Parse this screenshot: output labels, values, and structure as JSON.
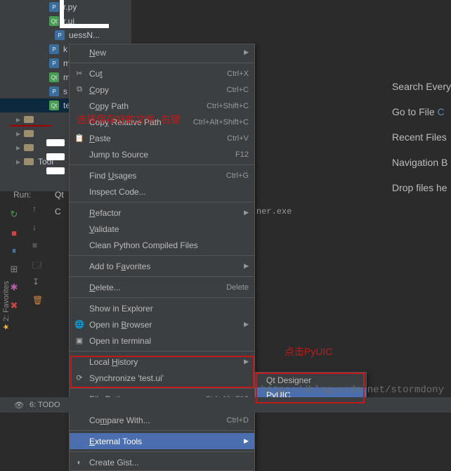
{
  "tree": {
    "items": [
      {
        "icon": "py",
        "label": "r.py"
      },
      {
        "icon": "ui",
        "label": "r.ui"
      },
      {
        "icon": "py",
        "label": "k"
      },
      {
        "icon": "py",
        "label": "m"
      },
      {
        "icon": "ui",
        "label": "m"
      },
      {
        "icon": "py",
        "label": "s"
      },
      {
        "icon": "py",
        "label": "te",
        "selected": true
      },
      {
        "icon": "folder",
        "label": ""
      },
      {
        "icon": "folder",
        "label": ""
      },
      {
        "icon": "folder",
        "label": ""
      },
      {
        "icon": "folder",
        "label": "Tool"
      }
    ]
  },
  "menu": {
    "new": "New",
    "cut": "Cut",
    "cut_sc": "Ctrl+X",
    "copy": "Copy",
    "copy_sc": "Ctrl+C",
    "copy_path": "Copy Path",
    "copy_path_sc": "Ctrl+Shift+C",
    "copy_rel": "Copy Relative Path",
    "copy_rel_sc": "Ctrl+Alt+Shift+C",
    "paste": "Paste",
    "paste_sc": "Ctrl+V",
    "jump": "Jump to Source",
    "jump_sc": "F12",
    "find_usages": "Find Usages",
    "find_usages_sc": "Ctrl+G",
    "inspect": "Inspect Code...",
    "refactor": "Refactor",
    "validate": "Validate",
    "clean": "Clean Python Compiled Files",
    "add_fav": "Add to Favorites",
    "delete": "Delete...",
    "delete_sc": "Delete",
    "show_explorer": "Show in Explorer",
    "open_browser": "Open in Browser",
    "open_terminal": "Open in terminal",
    "local_history": "Local History",
    "sync": "Synchronize 'test.ui'",
    "file_path": "File Path",
    "file_path_sc": "Ctrl+Alt+F12",
    "compare": "Compare With...",
    "compare_sc": "Ctrl+D",
    "ext_tools": "External Tools",
    "create_gist": "Create Gist..."
  },
  "submenu": {
    "qt_designer": "Qt Designer",
    "pyuic": "PyUIC"
  },
  "right": {
    "search": "Search Every",
    "goto": "Go to File",
    "recent": "Recent Files",
    "nav": "Navigation B",
    "drop": "Drop files he"
  },
  "run": {
    "label": "Run:",
    "config": "Qt",
    "code": "C",
    "exe": "ner.exe"
  },
  "bottom": {
    "todo": "6: TODO"
  },
  "sidebar": {
    "fav": "2: Favorites"
  },
  "annotations": {
    "top": "选择保存好的文件, 右键",
    "right": "点击PyUIC"
  },
  "watermark": "https://blog.csdn.net/stormdony"
}
